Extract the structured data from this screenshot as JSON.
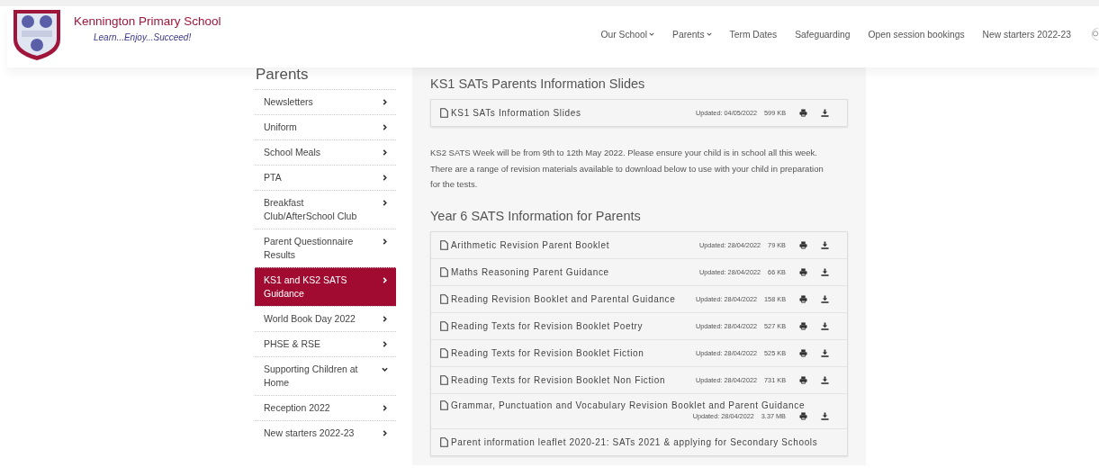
{
  "header": {
    "school_name": "Kennington Primary School",
    "motto": "Learn...Enjoy...Succeed!",
    "nav": [
      {
        "label": "Our School",
        "dropdown": true
      },
      {
        "label": "Parents",
        "dropdown": true
      },
      {
        "label": "Term Dates",
        "dropdown": false
      },
      {
        "label": "Safeguarding",
        "dropdown": false
      },
      {
        "label": "Open session bookings",
        "dropdown": false
      },
      {
        "label": "New starters 2022-23",
        "dropdown": false
      }
    ]
  },
  "sidebar": {
    "title": "Parents",
    "items": [
      {
        "label": "Newsletters",
        "selected": false,
        "expanded": false
      },
      {
        "label": "Uniform",
        "selected": false,
        "expanded": false
      },
      {
        "label": "School Meals",
        "selected": false,
        "expanded": false
      },
      {
        "label": "PTA",
        "selected": false,
        "expanded": false
      },
      {
        "label": "Breakfast Club/AfterSchool Club",
        "selected": false,
        "expanded": false
      },
      {
        "label": "Parent Questionnaire Results",
        "selected": false,
        "expanded": false
      },
      {
        "label": "KS1 and KS2 SATS Guidance",
        "selected": true,
        "expanded": false
      },
      {
        "label": "World Book Day 2022",
        "selected": false,
        "expanded": false
      },
      {
        "label": "PHSE & RSE",
        "selected": false,
        "expanded": false
      },
      {
        "label": "Supporting Children at Home",
        "selected": false,
        "expanded": true
      },
      {
        "label": "Reception 2022",
        "selected": false,
        "expanded": false
      },
      {
        "label": "New starters 2022-23",
        "selected": false,
        "expanded": false
      }
    ]
  },
  "content": [
    {
      "kind": "heading",
      "text": "KS1 SATs Parents Information Slides"
    },
    {
      "kind": "documents",
      "items": [
        {
          "title": "KS1 SATs Information Slides",
          "updated": "Updated: 04/05/2022",
          "size": "599 KB"
        }
      ]
    },
    {
      "kind": "paragraph",
      "text": "KS2 SATS Week will be from 9th to 12th May 2022. Please ensure your child is in school all this week.  There are a range of revision materials available to download below to use with your child in preparation for the tests."
    },
    {
      "kind": "heading",
      "text": "Year 6 SATS Information for Parents"
    },
    {
      "kind": "documents",
      "items": [
        {
          "title": "Arithmetic Revision Parent Booklet",
          "updated": "Updated: 28/04/2022",
          "size": "79 KB"
        },
        {
          "title": "Maths Reasoning Parent Guidance",
          "updated": "Updated: 28/04/2022",
          "size": "66 KB"
        },
        {
          "title": "Reading Revision Booklet and Parental Guidance",
          "updated": "Updated: 28/04/2022",
          "size": "158 KB"
        },
        {
          "title": "Reading Texts for Revision Booklet Poetry",
          "updated": "Updated: 28/04/2022",
          "size": "527 KB"
        },
        {
          "title": "Reading Texts for Revision Booklet Fiction",
          "updated": "Updated: 28/04/2022",
          "size": "525 KB"
        },
        {
          "title": "Reading Texts for Revision Booklet Non Fiction",
          "updated": "Updated: 28/04/2022",
          "size": "731 KB"
        },
        {
          "title": "Grammar, Punctuation and Vocabulary Revision Booklet and Parent Guidance",
          "updated": "Updated: 28/04/2022",
          "size": "3.37 MB"
        },
        {
          "title": "Parent information leaflet 2020-21: SATs 2021 & applying for Secondary Schools"
        }
      ]
    }
  ]
}
